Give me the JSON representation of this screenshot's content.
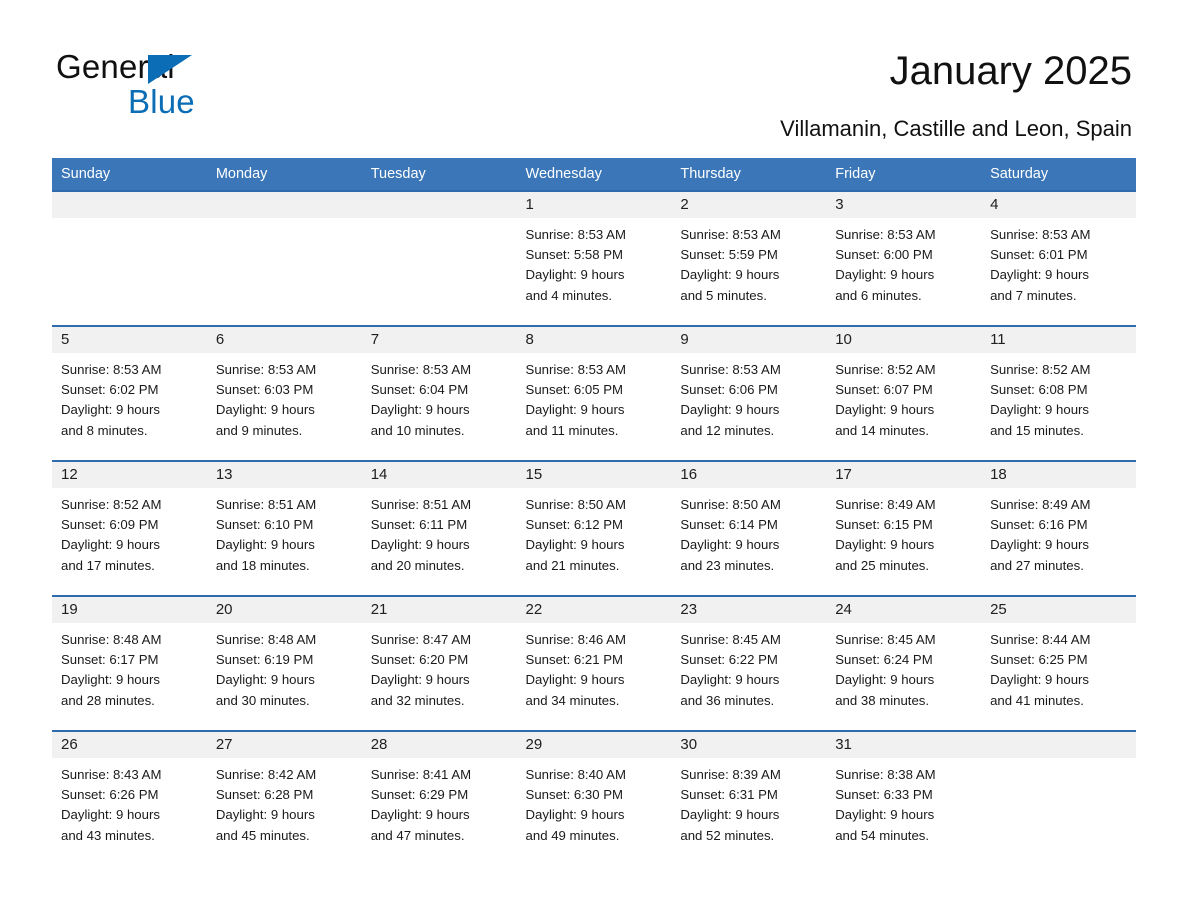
{
  "brand": {
    "word1": "General",
    "word2": "Blue",
    "accent_color": "#0a6db5"
  },
  "header": {
    "title": "January 2025",
    "subtitle": "Villamanin, Castille and Leon, Spain"
  },
  "theme": {
    "header_bg": "#3a76b8",
    "row_rule": "#2f6cad",
    "daynum_bg": "#f1f1f1"
  },
  "weekday_headers": [
    "Sunday",
    "Monday",
    "Tuesday",
    "Wednesday",
    "Thursday",
    "Friday",
    "Saturday"
  ],
  "weeks": [
    [
      {
        "day": "",
        "info": ""
      },
      {
        "day": "",
        "info": ""
      },
      {
        "day": "",
        "info": ""
      },
      {
        "day": "1",
        "info": "Sunrise: 8:53 AM\nSunset: 5:58 PM\nDaylight: 9 hours\nand 4 minutes."
      },
      {
        "day": "2",
        "info": "Sunrise: 8:53 AM\nSunset: 5:59 PM\nDaylight: 9 hours\nand 5 minutes."
      },
      {
        "day": "3",
        "info": "Sunrise: 8:53 AM\nSunset: 6:00 PM\nDaylight: 9 hours\nand 6 minutes."
      },
      {
        "day": "4",
        "info": "Sunrise: 8:53 AM\nSunset: 6:01 PM\nDaylight: 9 hours\nand 7 minutes."
      }
    ],
    [
      {
        "day": "5",
        "info": "Sunrise: 8:53 AM\nSunset: 6:02 PM\nDaylight: 9 hours\nand 8 minutes."
      },
      {
        "day": "6",
        "info": "Sunrise: 8:53 AM\nSunset: 6:03 PM\nDaylight: 9 hours\nand 9 minutes."
      },
      {
        "day": "7",
        "info": "Sunrise: 8:53 AM\nSunset: 6:04 PM\nDaylight: 9 hours\nand 10 minutes."
      },
      {
        "day": "8",
        "info": "Sunrise: 8:53 AM\nSunset: 6:05 PM\nDaylight: 9 hours\nand 11 minutes."
      },
      {
        "day": "9",
        "info": "Sunrise: 8:53 AM\nSunset: 6:06 PM\nDaylight: 9 hours\nand 12 minutes."
      },
      {
        "day": "10",
        "info": "Sunrise: 8:52 AM\nSunset: 6:07 PM\nDaylight: 9 hours\nand 14 minutes."
      },
      {
        "day": "11",
        "info": "Sunrise: 8:52 AM\nSunset: 6:08 PM\nDaylight: 9 hours\nand 15 minutes."
      }
    ],
    [
      {
        "day": "12",
        "info": "Sunrise: 8:52 AM\nSunset: 6:09 PM\nDaylight: 9 hours\nand 17 minutes."
      },
      {
        "day": "13",
        "info": "Sunrise: 8:51 AM\nSunset: 6:10 PM\nDaylight: 9 hours\nand 18 minutes."
      },
      {
        "day": "14",
        "info": "Sunrise: 8:51 AM\nSunset: 6:11 PM\nDaylight: 9 hours\nand 20 minutes."
      },
      {
        "day": "15",
        "info": "Sunrise: 8:50 AM\nSunset: 6:12 PM\nDaylight: 9 hours\nand 21 minutes."
      },
      {
        "day": "16",
        "info": "Sunrise: 8:50 AM\nSunset: 6:14 PM\nDaylight: 9 hours\nand 23 minutes."
      },
      {
        "day": "17",
        "info": "Sunrise: 8:49 AM\nSunset: 6:15 PM\nDaylight: 9 hours\nand 25 minutes."
      },
      {
        "day": "18",
        "info": "Sunrise: 8:49 AM\nSunset: 6:16 PM\nDaylight: 9 hours\nand 27 minutes."
      }
    ],
    [
      {
        "day": "19",
        "info": "Sunrise: 8:48 AM\nSunset: 6:17 PM\nDaylight: 9 hours\nand 28 minutes."
      },
      {
        "day": "20",
        "info": "Sunrise: 8:48 AM\nSunset: 6:19 PM\nDaylight: 9 hours\nand 30 minutes."
      },
      {
        "day": "21",
        "info": "Sunrise: 8:47 AM\nSunset: 6:20 PM\nDaylight: 9 hours\nand 32 minutes."
      },
      {
        "day": "22",
        "info": "Sunrise: 8:46 AM\nSunset: 6:21 PM\nDaylight: 9 hours\nand 34 minutes."
      },
      {
        "day": "23",
        "info": "Sunrise: 8:45 AM\nSunset: 6:22 PM\nDaylight: 9 hours\nand 36 minutes."
      },
      {
        "day": "24",
        "info": "Sunrise: 8:45 AM\nSunset: 6:24 PM\nDaylight: 9 hours\nand 38 minutes."
      },
      {
        "day": "25",
        "info": "Sunrise: 8:44 AM\nSunset: 6:25 PM\nDaylight: 9 hours\nand 41 minutes."
      }
    ],
    [
      {
        "day": "26",
        "info": "Sunrise: 8:43 AM\nSunset: 6:26 PM\nDaylight: 9 hours\nand 43 minutes."
      },
      {
        "day": "27",
        "info": "Sunrise: 8:42 AM\nSunset: 6:28 PM\nDaylight: 9 hours\nand 45 minutes."
      },
      {
        "day": "28",
        "info": "Sunrise: 8:41 AM\nSunset: 6:29 PM\nDaylight: 9 hours\nand 47 minutes."
      },
      {
        "day": "29",
        "info": "Sunrise: 8:40 AM\nSunset: 6:30 PM\nDaylight: 9 hours\nand 49 minutes."
      },
      {
        "day": "30",
        "info": "Sunrise: 8:39 AM\nSunset: 6:31 PM\nDaylight: 9 hours\nand 52 minutes."
      },
      {
        "day": "31",
        "info": "Sunrise: 8:38 AM\nSunset: 6:33 PM\nDaylight: 9 hours\nand 54 minutes."
      },
      {
        "day": "",
        "info": ""
      }
    ]
  ]
}
